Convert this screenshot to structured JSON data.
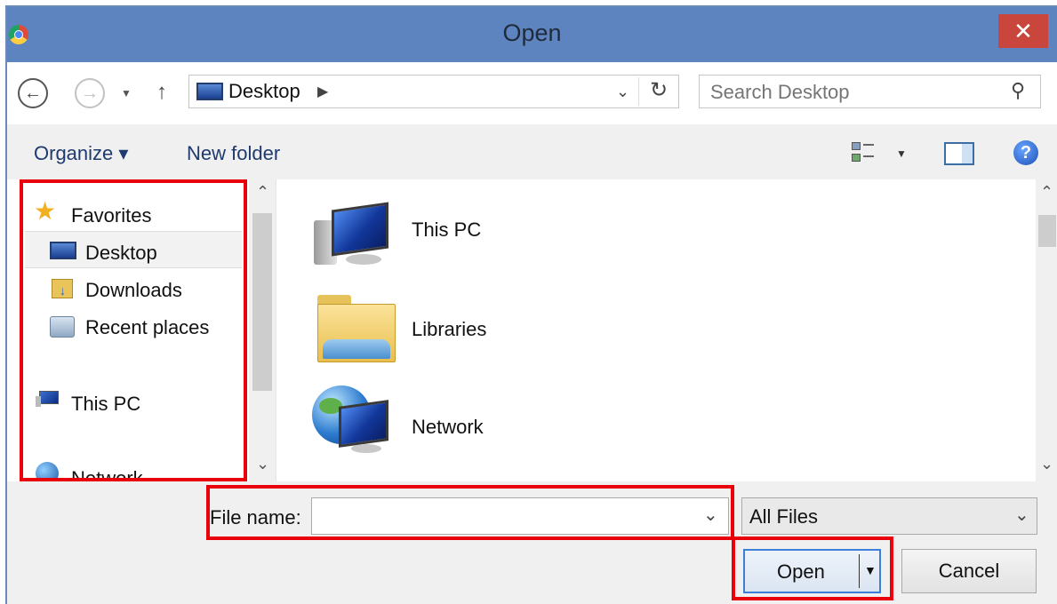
{
  "window": {
    "title": "Open",
    "close_glyph": "✕"
  },
  "address_bar": {
    "path_segment": "Desktop",
    "search_placeholder": "Search Desktop"
  },
  "toolbar": {
    "organize_label": "Organize ▾",
    "new_folder_label": "New folder"
  },
  "nav_pane": {
    "favorites_label": "Favorites",
    "items": [
      {
        "label": "Desktop",
        "icon": "desktop-icon"
      },
      {
        "label": "Downloads",
        "icon": "downloads-folder-icon"
      },
      {
        "label": "Recent places",
        "icon": "recent-places-icon"
      }
    ],
    "this_pc_label": "This PC",
    "network_label": "Network"
  },
  "content": {
    "items": [
      {
        "label": "This PC",
        "icon": "computer-icon"
      },
      {
        "label": "Libraries",
        "icon": "libraries-folder-icon"
      },
      {
        "label": "Network",
        "icon": "network-globe-icon"
      }
    ]
  },
  "footer": {
    "file_name_label": "File name:",
    "file_name_value": "",
    "file_type_filter": "All Files",
    "open_label": "Open",
    "cancel_label": "Cancel"
  },
  "colors": {
    "titlebar": "#5e84bf",
    "close": "#c9463d",
    "highlight_box": "#e8000b",
    "link_text": "#1e3a6e"
  }
}
